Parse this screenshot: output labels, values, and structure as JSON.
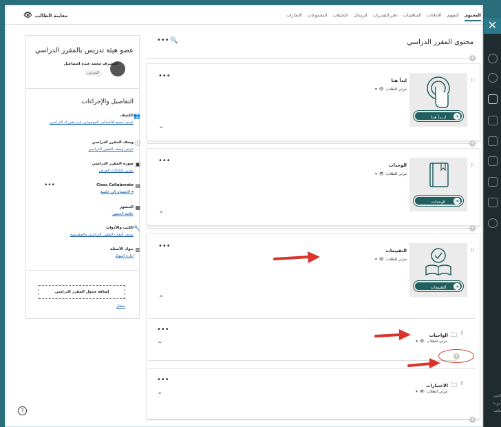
{
  "topbar": {
    "student_preview": "معاينة الطالب",
    "tabs": [
      "المحتوى",
      "التقويم",
      "الإعلانات",
      "المناقشات",
      "دفتر التقديرات",
      "الرسائل",
      "التحليلات",
      "المجموعات",
      "الإنجازات"
    ]
  },
  "instructor": {
    "title": "عضو هيئة تدريس بالمقرر الدراسي",
    "name": "المشرف محمد عبده اسماعيل",
    "role": "المدرس"
  },
  "details": {
    "title": "التفاصيل والإجراءات",
    "items": [
      {
        "label": "الكشف",
        "link": "عرض جميع الأشخاص الموجودين في مقررك الدراسي"
      },
      {
        "label": "وصف المقرر الدراسي",
        "link": "عرض وصف المقرر الدراسي"
      },
      {
        "label": "صورة المقرر الدراسي",
        "link": "تحرير إعدادات العرض"
      },
      {
        "label": "Class Collaborate",
        "link": "الانضمام إلى جلسة ▾"
      },
      {
        "label": "الحضور",
        "link": "علامة الحضور"
      },
      {
        "label": "الكتب والأدوات",
        "link": "عرض أدوات المقرر الدراسي والمؤسسة"
      },
      {
        "label": "بنوك الأسئلة",
        "link": "إدارة البنوك"
      }
    ],
    "add_schedule": "إضافة جدول المقرر الدراسي",
    "disabled": "تعطل"
  },
  "content": {
    "title": "محتوى المقرر الدراسي",
    "visibility": "مرئي للطلاب",
    "items": [
      {
        "title": "ابدأ هنا",
        "button": "ابــدأ هنـا"
      },
      {
        "title": "الوحدات",
        "button": "الوحدات"
      },
      {
        "title": "التقييمات",
        "button": "التقييمات"
      }
    ],
    "subitems": [
      {
        "title": "الواجبات"
      },
      {
        "title": "الاختبارات"
      }
    ]
  },
  "rail": {
    "side_text": [
      "المس",
      "ترونيا",
      "هاتف"
    ]
  },
  "colors": {
    "brand": "#2b6d7a",
    "button": "#1f5f5f",
    "arrow": "#d9342b",
    "link": "#1a5fa8"
  }
}
